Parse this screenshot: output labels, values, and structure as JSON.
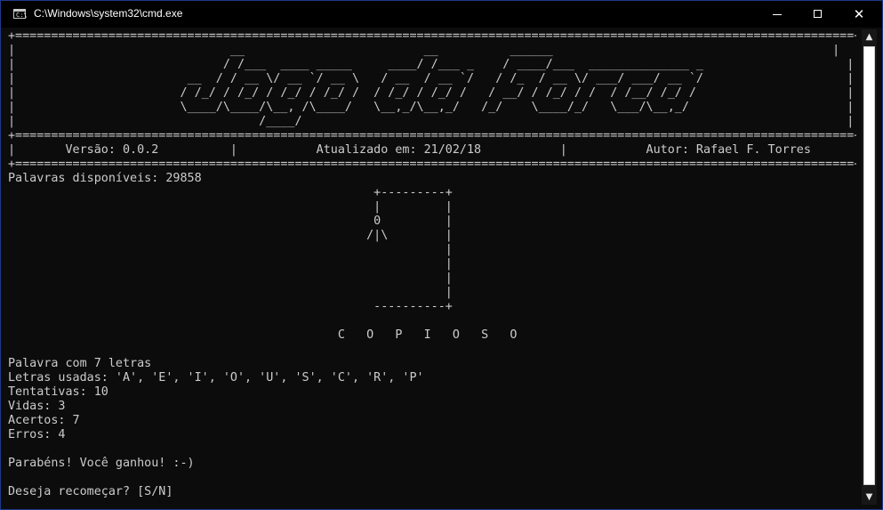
{
  "window": {
    "title": "C:\\Windows\\system32\\cmd.exe",
    "icon_name": "console-icon",
    "icon_text": "C:\\",
    "minimize_symbol": "",
    "close_symbol": "✕"
  },
  "console": {
    "lines": [
      "+=====================================================================================================================+",
      "|                              __                         __          ______                                       |",
      "|                             / /___  ____ _____     ____/ /___ _    / ____/___  ______________ _                    |",
      "|                        __  / / __ \\/ __ `/ __ \\   / __  / __ `/   / /_  / __ \\/ ___/ ___/ __ `/                    |",
      "|                       / /_/ / /_/ / /_/ / /_/ /  / /_/ / /_/ /   / __/ / /_/ / /  / /__/ /_/ /                     |",
      "|                       \\____/\\____/\\__, /\\____/   \\__,_/\\__,_/   /_/    \\____/_/   \\___/\\__,_/                      |",
      "|                                  /____/                                                                            |",
      "+=====================================================================================================================+",
      "|       Versão: 0.0.2          |           Atualizado em: 21/02/18           |           Autor: Rafael F. Torres        |",
      "+=====================================================================================================================+",
      "Palavras disponíveis: 29858",
      "                                                   +---------+",
      "                                                   |         |",
      "                                                   0         |",
      "                                                  /|\\        |",
      "                                                             |",
      "                                                             |",
      "                                                             |",
      "                                                             |",
      "                                                   ----------+",
      "",
      "                                              C   O   P   I   O   S   O",
      "",
      "Palavra com 7 letras",
      "Letras usadas: 'A', 'E', 'I', 'O', 'U', 'S', 'C', 'R', 'P'",
      "Tentativas: 10",
      "Vidas: 3",
      "Acertos: 7",
      "Erros: 4",
      "",
      "Parabéns! Você ganhou! :-)",
      "",
      "Deseja recomeçar? [S/N]"
    ]
  },
  "scrollbar": {
    "up_arrow": "▲",
    "down_arrow": "▼"
  }
}
